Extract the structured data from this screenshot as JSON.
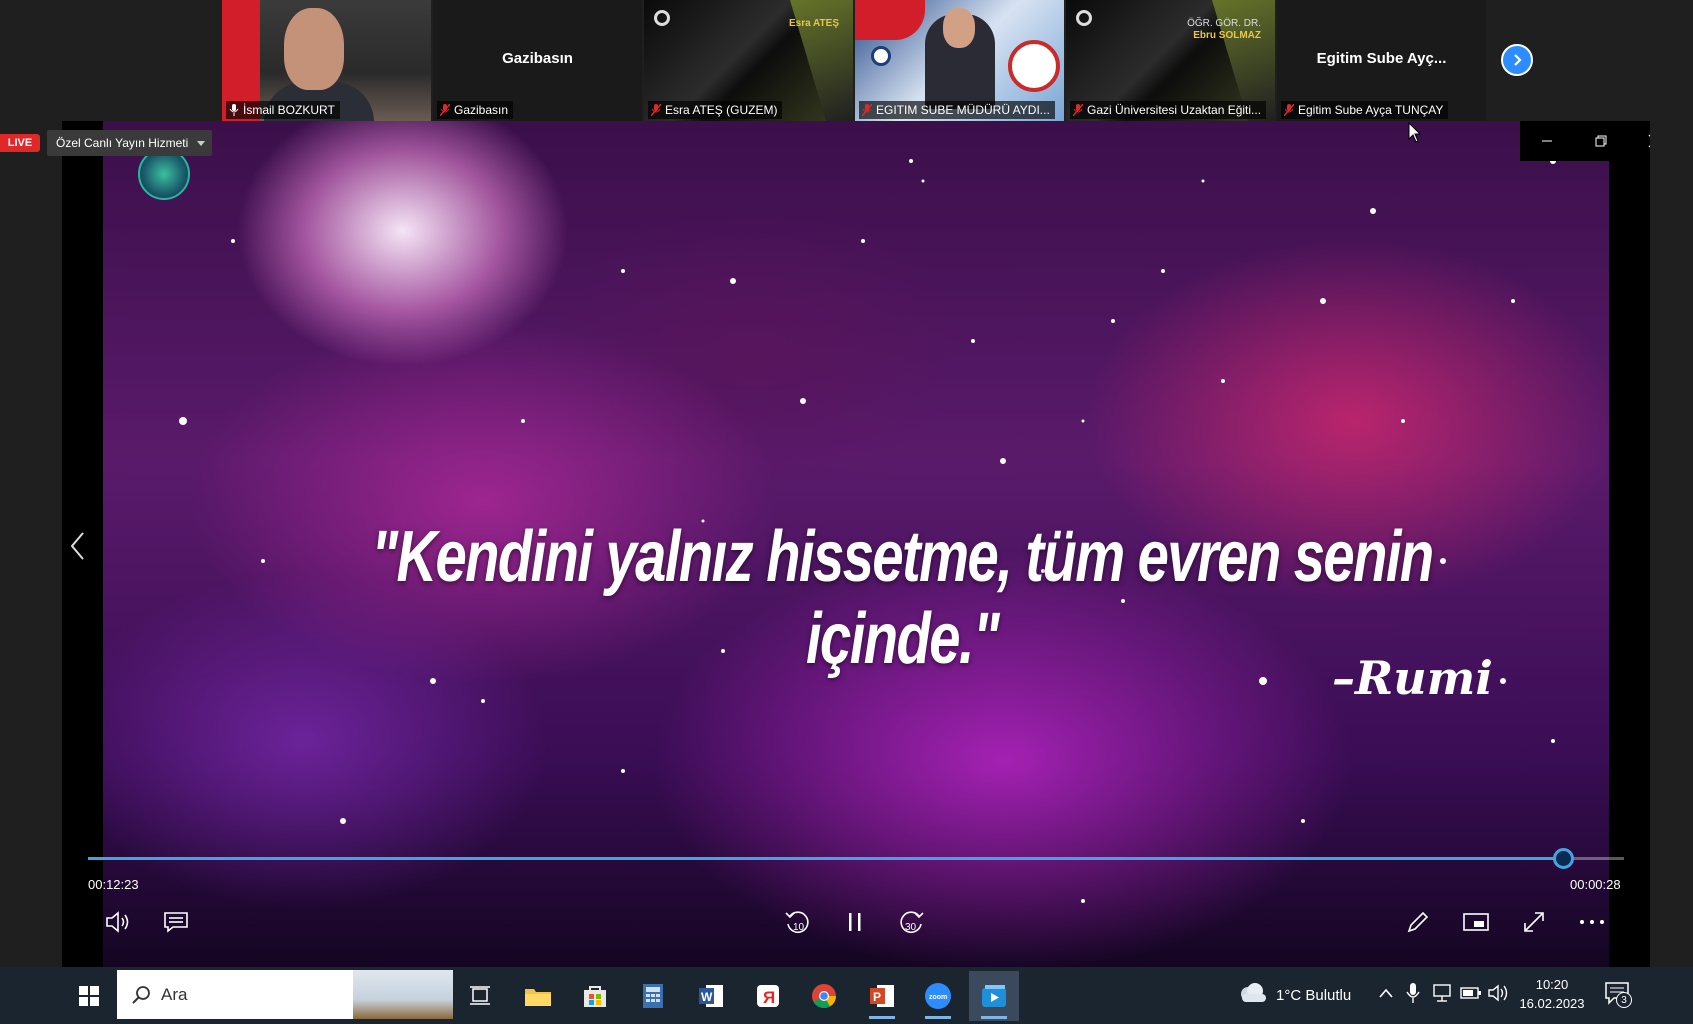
{
  "participants": [
    {
      "name": "İsmail BOZKURT",
      "active": true,
      "muted": false
    },
    {
      "name": "Gazibasın",
      "center_name": "Gazibasın",
      "muted": true
    },
    {
      "name": "Esra ATEŞ (GUZEM)",
      "muted": true,
      "overlay": "Esra ATEŞ"
    },
    {
      "name": "EGITIM SUBE MÜDÜRÜ AYDI...",
      "muted": true
    },
    {
      "name": "Gazi Üniversitesi Uzaktan Eğiti...",
      "muted": true,
      "overlay_line1": "ÖĞR. GÖR. DR.",
      "overlay_line2": "Ebru SOLMAZ"
    },
    {
      "name": "Egitim Sube Ayça TUNÇAY",
      "center_name": "Egitim Sube Ayç...",
      "muted": true
    }
  ],
  "stream": {
    "live_label": "LIVE",
    "service": "Özel Canlı Yayın Hizmeti"
  },
  "video": {
    "quote": "\"Kendini yalnız hissetme, tüm evren senin içinde.\"",
    "author": "–Rumi",
    "elapsed": "00:12:23",
    "remaining": "00:00:28",
    "progress": 0.96
  },
  "taskbar": {
    "search_placeholder": "Ara",
    "weather": "1°C  Bulutlu",
    "time": "10:20",
    "date": "16.02.2023",
    "notifications": "3"
  },
  "colors": {
    "accent": "#43a4e3",
    "live": "#e02828",
    "zoom_blue": "#2d8cff",
    "taskbar": "#1b2530"
  }
}
